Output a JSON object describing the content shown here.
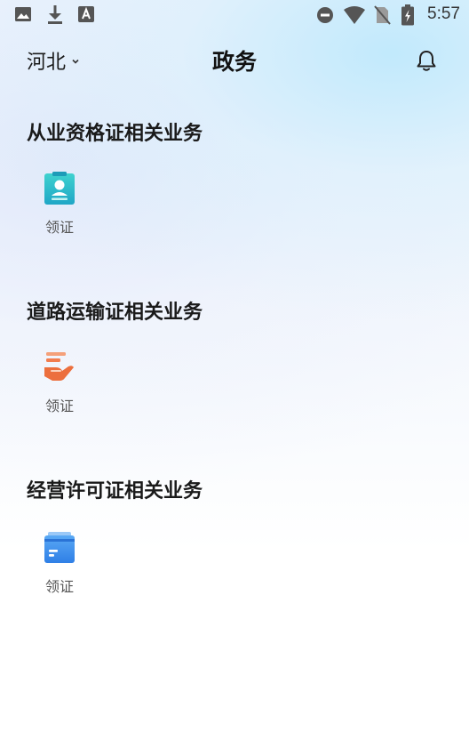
{
  "status_bar": {
    "time": "5:57",
    "left_icons": [
      "image-icon",
      "download-icon",
      "app-a-icon"
    ],
    "right_icons": [
      "do-not-disturb-icon",
      "wifi-icon",
      "no-sim-icon",
      "battery-charging-icon"
    ]
  },
  "header": {
    "region": "河北",
    "title": "政务",
    "right_icon": "bell-icon"
  },
  "sections": [
    {
      "title": "从业资格证相关业务",
      "items": [
        {
          "label": "领证",
          "icon": "id-badge-icon",
          "color": "#2bbfc7"
        }
      ]
    },
    {
      "title": "道路运输证相关业务",
      "items": [
        {
          "label": "领证",
          "icon": "hand-card-icon",
          "color": "#f07a4a"
        }
      ]
    },
    {
      "title": "经营许可证相关业务",
      "items": [
        {
          "label": "领证",
          "icon": "wallet-card-icon",
          "color": "#3d8ff0"
        }
      ]
    }
  ],
  "colors": {
    "accent_teal": "#2bbfc7",
    "accent_orange": "#f07a4a",
    "accent_blue": "#3d8ff0"
  }
}
